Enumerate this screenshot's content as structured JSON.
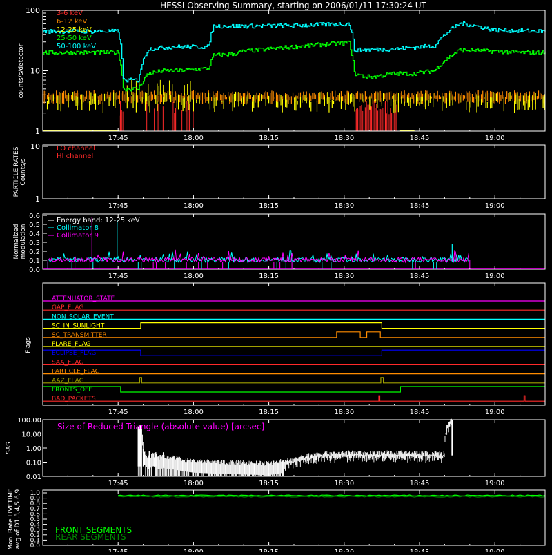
{
  "title": "HESSI Observing Summary, starting on 2006/01/11 17:30:24 UT",
  "time_ticks": [
    "17:45",
    "18:00",
    "18:15",
    "18:30",
    "18:45",
    "19:00"
  ],
  "colors": {
    "red": "#ff2a2a",
    "orange": "#ff8c00",
    "yellow": "#ffff00",
    "green": "#00ff00",
    "cyan": "#00ffff",
    "magenta": "#ff00ff",
    "blue": "#0000ff",
    "olive": "#a0a000",
    "darkgreen": "#008800",
    "white": "#ffffff"
  },
  "chart_data": [
    {
      "type": "line",
      "panel": "count_rates",
      "ylabel": "counts/s/detector",
      "ylog": true,
      "ylim": [
        1,
        100
      ],
      "yticks": [
        "1",
        "10",
        "100"
      ],
      "xlim_minutes": [
        0,
        100
      ],
      "series": [
        {
          "name": "3-6 keV",
          "color": "red"
        },
        {
          "name": "6-12 keV",
          "color": "orange"
        },
        {
          "name": "12-25 keV",
          "color": "yellow"
        },
        {
          "name": "25-50 keV",
          "color": "green",
          "x": [
            0,
            15,
            16,
            19,
            21,
            24,
            27,
            33,
            34,
            38,
            40,
            45,
            50,
            55,
            61,
            62,
            64,
            66,
            70,
            74,
            78,
            83,
            90,
            95,
            100
          ],
          "y": [
            20,
            20,
            5,
            5,
            9,
            10,
            10,
            11,
            18,
            19,
            21,
            23,
            25,
            27,
            29,
            9,
            8,
            8,
            9,
            9,
            10,
            22,
            21,
            20,
            20
          ]
        },
        {
          "name": "50-100 keV",
          "color": "cyan",
          "x": [
            0,
            15,
            16,
            19,
            21,
            26,
            33,
            34,
            40,
            50,
            55,
            61,
            62,
            70,
            78,
            83,
            84,
            90,
            100
          ],
          "y": [
            45,
            45,
            7,
            7,
            23,
            25,
            25,
            55,
            55,
            56,
            58,
            60,
            22,
            23,
            26,
            60,
            60,
            47,
            45
          ]
        }
      ]
    },
    {
      "type": "line",
      "panel": "particle_rates",
      "ylabel": "PARTICLE RATES\nCounts/s",
      "yticks": [
        "1",
        "10"
      ],
      "series": [
        {
          "name": "LO channel",
          "color": "red"
        },
        {
          "name": "HI channel",
          "color": "red"
        }
      ]
    },
    {
      "type": "line",
      "panel": "modulation",
      "ylabel": "Normalized\nmodulation",
      "ylim": [
        0,
        0.6
      ],
      "yticks": [
        "0.0",
        "0.1",
        "0.2",
        "0.3",
        "0.4",
        "0.5",
        "0.6"
      ],
      "annotation": "Energy band: 12-25 keV",
      "series": [
        {
          "name": "Collimator 8",
          "color": "cyan"
        },
        {
          "name": "Collimator 9",
          "color": "magenta"
        }
      ],
      "spikes": [
        {
          "x": 9.8,
          "y": 0.58,
          "color": "magenta"
        },
        {
          "x": 14.8,
          "y": 0.55,
          "color": "cyan"
        },
        {
          "x": 81.5,
          "y": 0.28,
          "color": "cyan"
        }
      ],
      "active_range": [
        1,
        85
      ]
    },
    {
      "type": "line",
      "panel": "flags",
      "ylabel": "Flags",
      "flags": [
        {
          "name": "ATTENUATOR_STATE",
          "color": "magenta",
          "high": []
        },
        {
          "name": "GAP_FLAG",
          "color": "red",
          "high": []
        },
        {
          "name": "NON_SOLAR_EVENT",
          "color": "cyan",
          "high": []
        },
        {
          "name": "SC_IN_SUNLIGHT",
          "color": "yellow",
          "high": [
            [
              19.5,
              67.5
            ]
          ]
        },
        {
          "name": "SC_TRANSMITTER",
          "color": "orange",
          "high": [
            [
              58.5,
              63.2
            ],
            [
              64.5,
              67.2
            ]
          ]
        },
        {
          "name": "FLARE_FLAG",
          "color": "yellow",
          "high": []
        },
        {
          "name": "ECLIPSE_FLAG",
          "color": "blue",
          "high": [
            [
              0,
              19.5
            ],
            [
              67.5,
              100
            ]
          ]
        },
        {
          "name": "SAA_FLAG",
          "color": "red",
          "high": []
        },
        {
          "name": "PARTICLE_FLAG",
          "color": "orange",
          "high": []
        },
        {
          "name": "AAZ_FLAG",
          "color": "olive",
          "high": [
            [
              19.3,
              19.7
            ],
            [
              67.3,
              67.8
            ]
          ]
        },
        {
          "name": "FRONTS_OFF",
          "color": "green",
          "high": [
            [
              0,
              15.5
            ],
            [
              71.2,
              100
            ]
          ]
        },
        {
          "name": "BAD_PACKETS",
          "color": "red",
          "high": [
            [
              66.9,
              67.1
            ],
            [
              95.8,
              96.0
            ]
          ]
        }
      ]
    },
    {
      "type": "area",
      "panel": "sas",
      "ylabel": "SAS",
      "ylog": true,
      "ylim": [
        0.01,
        100
      ],
      "yticks": [
        "0.01",
        "0.10",
        "1.00",
        "10.00",
        "100.00"
      ],
      "title": "Size of Reduced Triangle (absolute value) [arcsec]",
      "x": [
        19,
        19.5,
        20,
        21,
        22,
        23,
        24,
        26,
        28,
        30,
        35,
        40,
        45,
        48,
        50,
        52,
        55,
        60,
        65,
        70,
        75,
        80,
        81.5,
        82
      ],
      "y": [
        20,
        30,
        0.5,
        0.2,
        0.35,
        0.2,
        0.25,
        0.2,
        0.15,
        0.12,
        0.1,
        0.09,
        0.08,
        0.12,
        0.15,
        0.25,
        0.4,
        0.45,
        0.45,
        0.45,
        0.42,
        0.4,
        100,
        0.3
      ]
    },
    {
      "type": "line",
      "panel": "livetime",
      "ylabel": "Mon. Rate LIVETIME\navg of D1,3,4,5,6,9",
      "ylim": [
        0,
        1.0
      ],
      "yticks": [
        "0.0",
        "0.1",
        "0.2",
        "0.3",
        "0.4",
        "0.5",
        "0.6",
        "0.7",
        "0.8",
        "0.9",
        "1.0"
      ],
      "series": [
        {
          "name": "FRONT SEGMENTS",
          "color": "green",
          "value": 0.95
        },
        {
          "name": "REAR SEGMENTS",
          "color": "darkgreen",
          "value": 0.93
        }
      ]
    }
  ]
}
